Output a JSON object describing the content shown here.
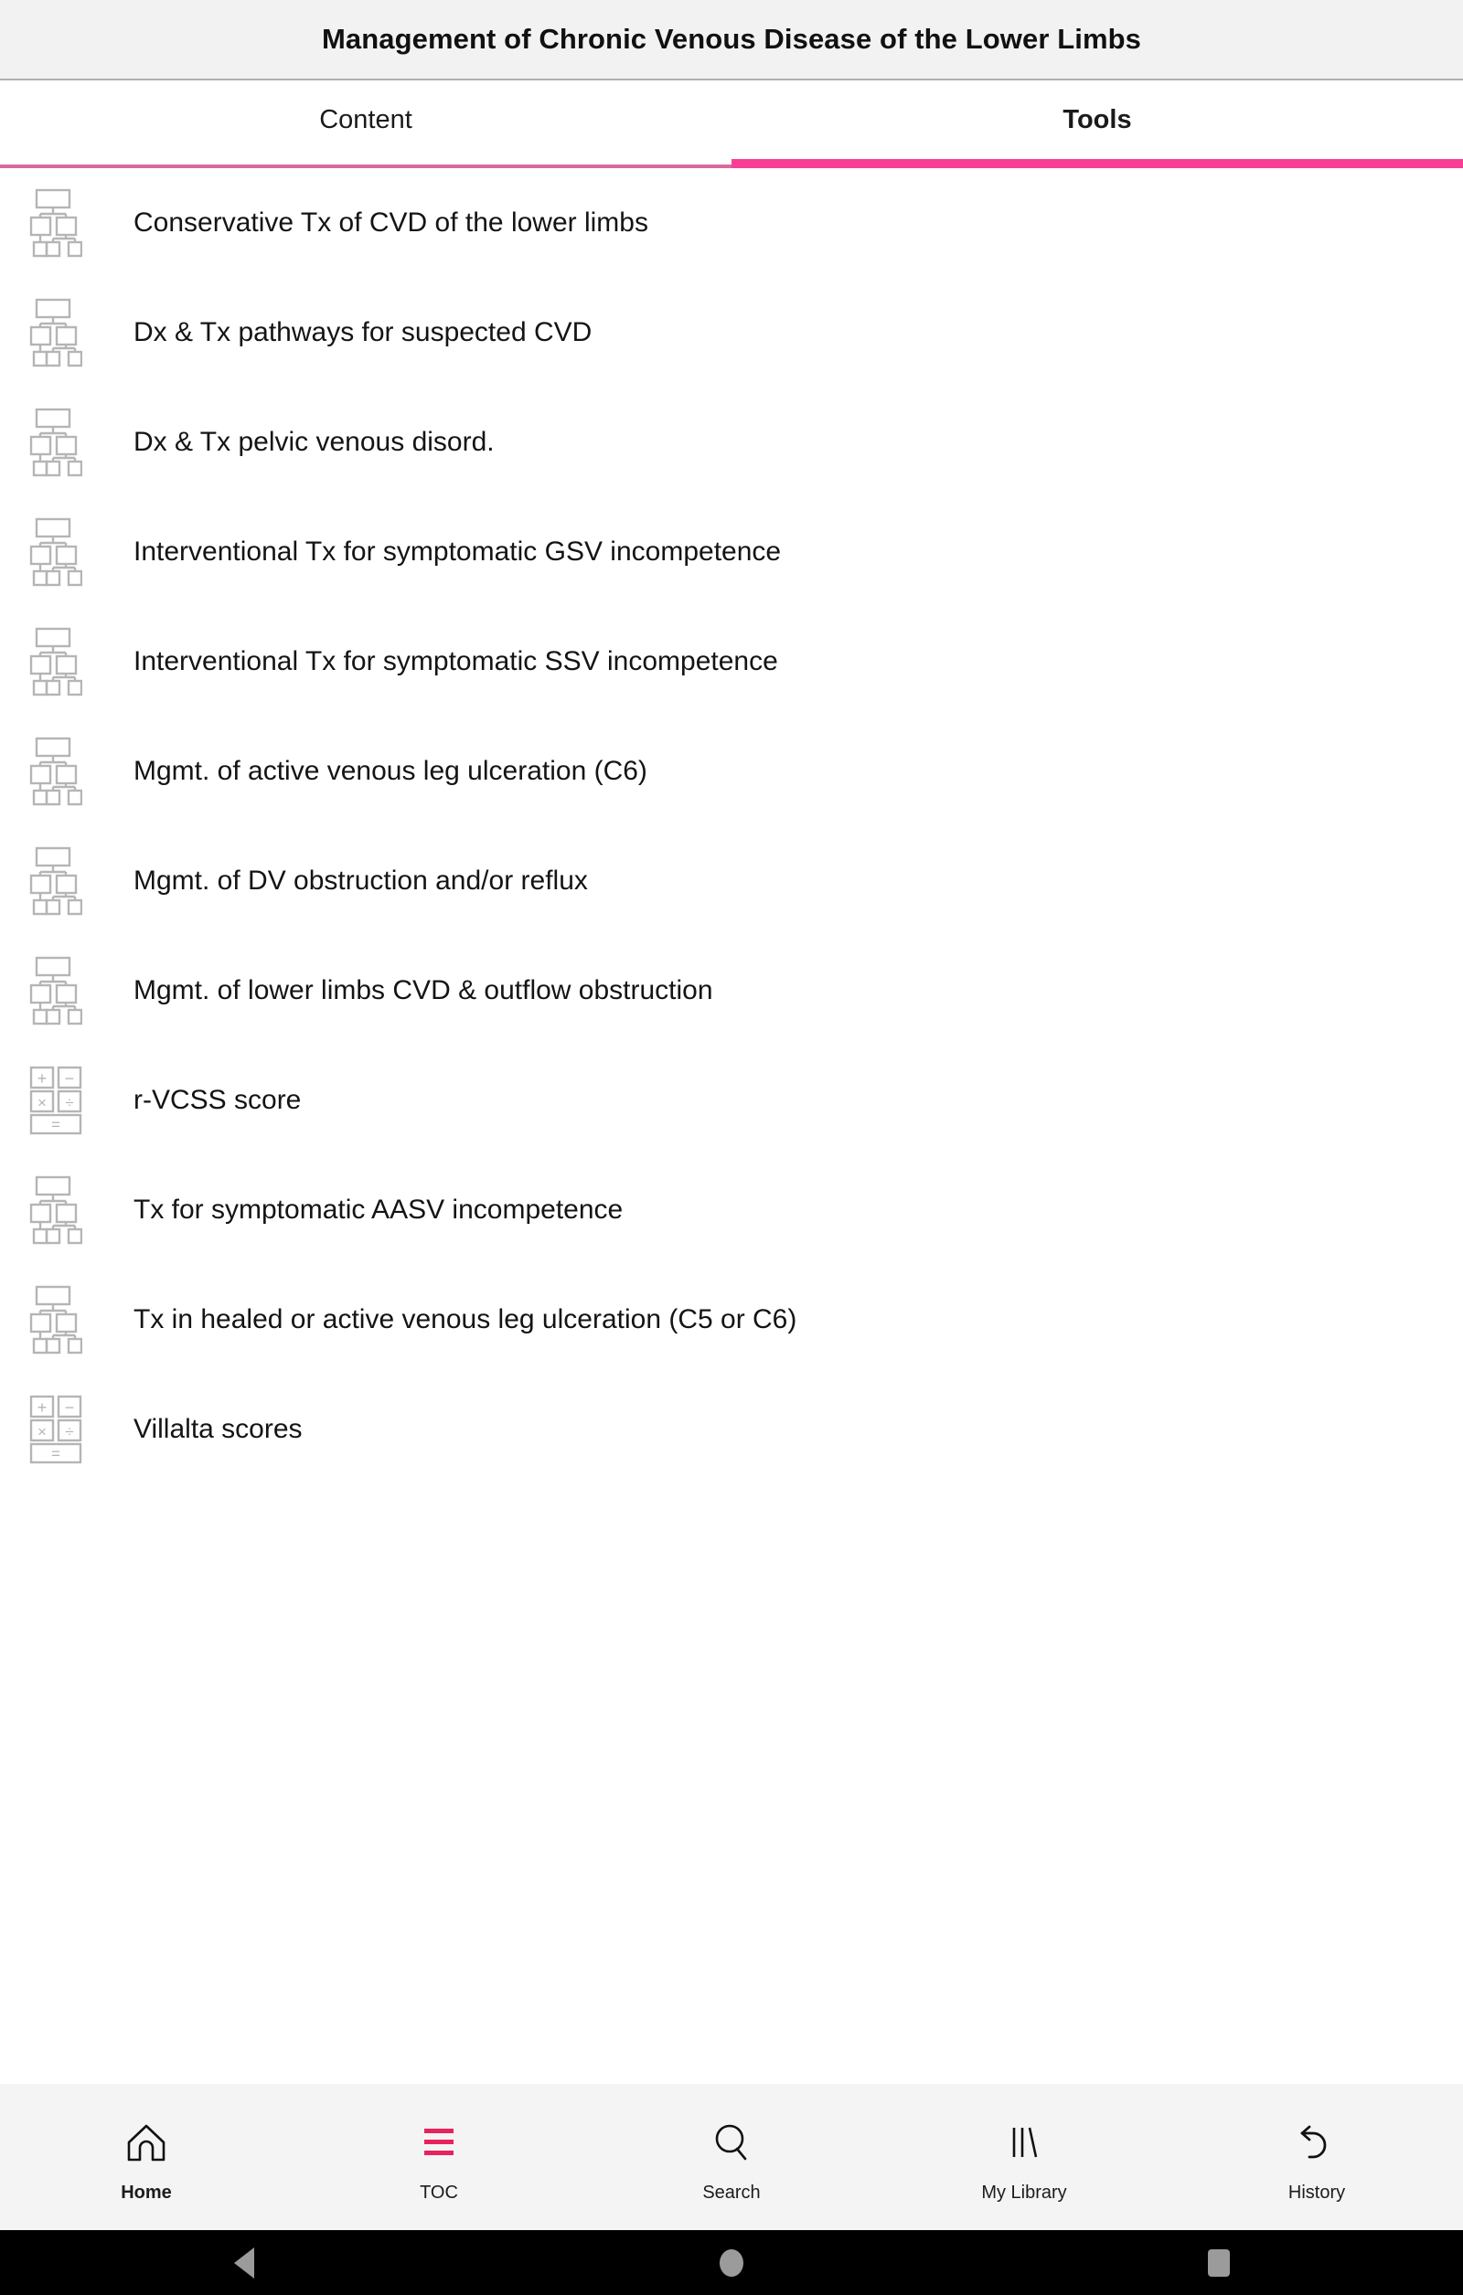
{
  "header": {
    "title": "Management of Chronic Venous Disease of the Lower Limbs"
  },
  "tabs": {
    "items": [
      {
        "label": "Content",
        "active": false
      },
      {
        "label": "Tools",
        "active": true
      }
    ],
    "active_indicator_color": "#f73f95",
    "inactive_indicator_color": "#d9699c"
  },
  "tool_list": {
    "items": [
      {
        "label": "Conservative Tx of CVD of the lower limbs",
        "icon": "flowchart-icon"
      },
      {
        "label": "Dx & Tx pathways for suspected CVD",
        "icon": "flowchart-icon"
      },
      {
        "label": "Dx & Tx pelvic venous disord.",
        "icon": "flowchart-icon"
      },
      {
        "label": "Interventional Tx for symptomatic GSV incompetence",
        "icon": "flowchart-icon"
      },
      {
        "label": "Interventional Tx for symptomatic SSV incompetence",
        "icon": "flowchart-icon"
      },
      {
        "label": "Mgmt. of active venous leg ulceration (C6)",
        "icon": "flowchart-icon"
      },
      {
        "label": "Mgmt. of DV obstruction and/or reflux",
        "icon": "flowchart-icon"
      },
      {
        "label": "Mgmt. of lower limbs CVD & outflow obstruction",
        "icon": "flowchart-icon"
      },
      {
        "label": "r-VCSS score",
        "icon": "calculator-icon"
      },
      {
        "label": "Tx for symptomatic AASV incompetence",
        "icon": "flowchart-icon"
      },
      {
        "label": "Tx in healed or active venous leg ulceration (C5 or C6)",
        "icon": "flowchart-icon"
      },
      {
        "label": "Villalta scores",
        "icon": "calculator-icon"
      }
    ]
  },
  "bottom_nav": {
    "items": [
      {
        "label": "Home",
        "icon": "home-icon",
        "active": true
      },
      {
        "label": "TOC",
        "icon": "toc-icon",
        "active": false
      },
      {
        "label": "Search",
        "icon": "search-icon",
        "active": false
      },
      {
        "label": "My Library",
        "icon": "library-icon",
        "active": false
      },
      {
        "label": "History",
        "icon": "history-undo-icon",
        "active": false
      }
    ],
    "toc_icon_color": "#e8215f"
  },
  "system_nav": {
    "buttons": [
      "back-button",
      "home-button",
      "recents-button"
    ]
  }
}
